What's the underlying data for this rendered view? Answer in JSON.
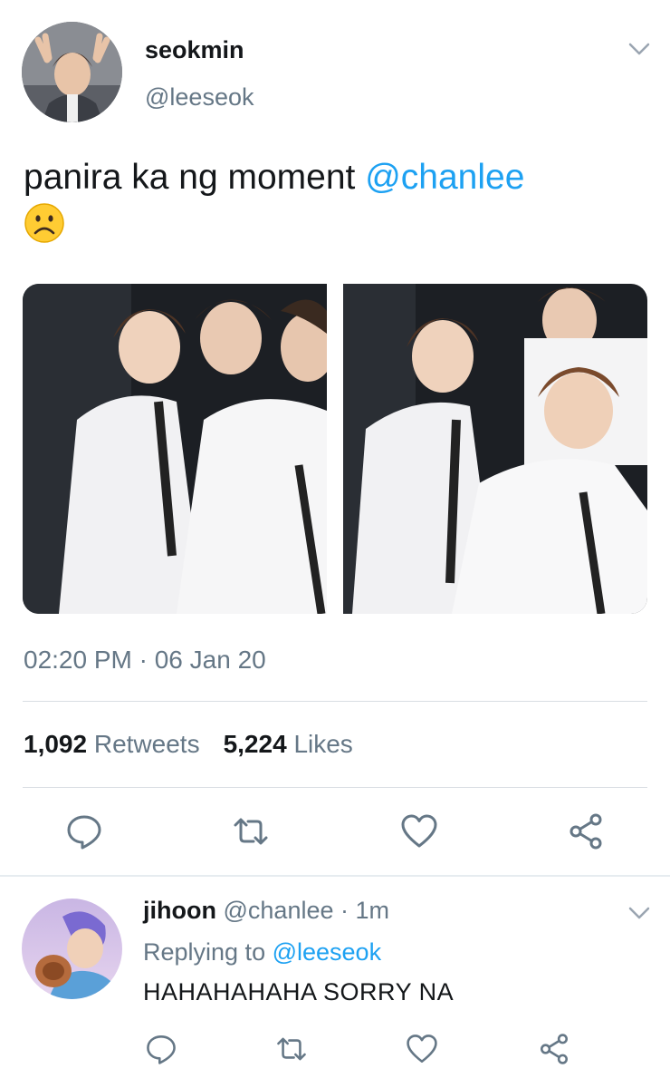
{
  "tweet": {
    "author_name": "seokmin",
    "author_handle": "@leeseok",
    "text_main": "panira ka ng moment ",
    "text_mention": "@chanlee",
    "emoji": "frowning-face",
    "timestamp": "02:20 PM · 06 Jan 20",
    "retweets_count": "1,092",
    "retweets_label": "Retweets",
    "likes_count": "5,224",
    "likes_label": "Likes",
    "photos": [
      "concert-photo-left",
      "concert-photo-right"
    ]
  },
  "reply": {
    "author_name": "jihoon",
    "author_handle": "@chanlee",
    "separator": " · ",
    "time": "1m",
    "replying_label": "Replying to ",
    "replying_to": "@leeseok",
    "text": "HAHAHAHAHA SORRY NA"
  },
  "icons": {
    "reply": "reply-icon",
    "retweet": "retweet-icon",
    "like": "heart-icon",
    "share": "share-icon",
    "more": "chevron-down-icon"
  },
  "colors": {
    "link": "#1da1f2",
    "secondary": "#657786",
    "primary": "#14171a",
    "divider": "#d9dee3"
  }
}
